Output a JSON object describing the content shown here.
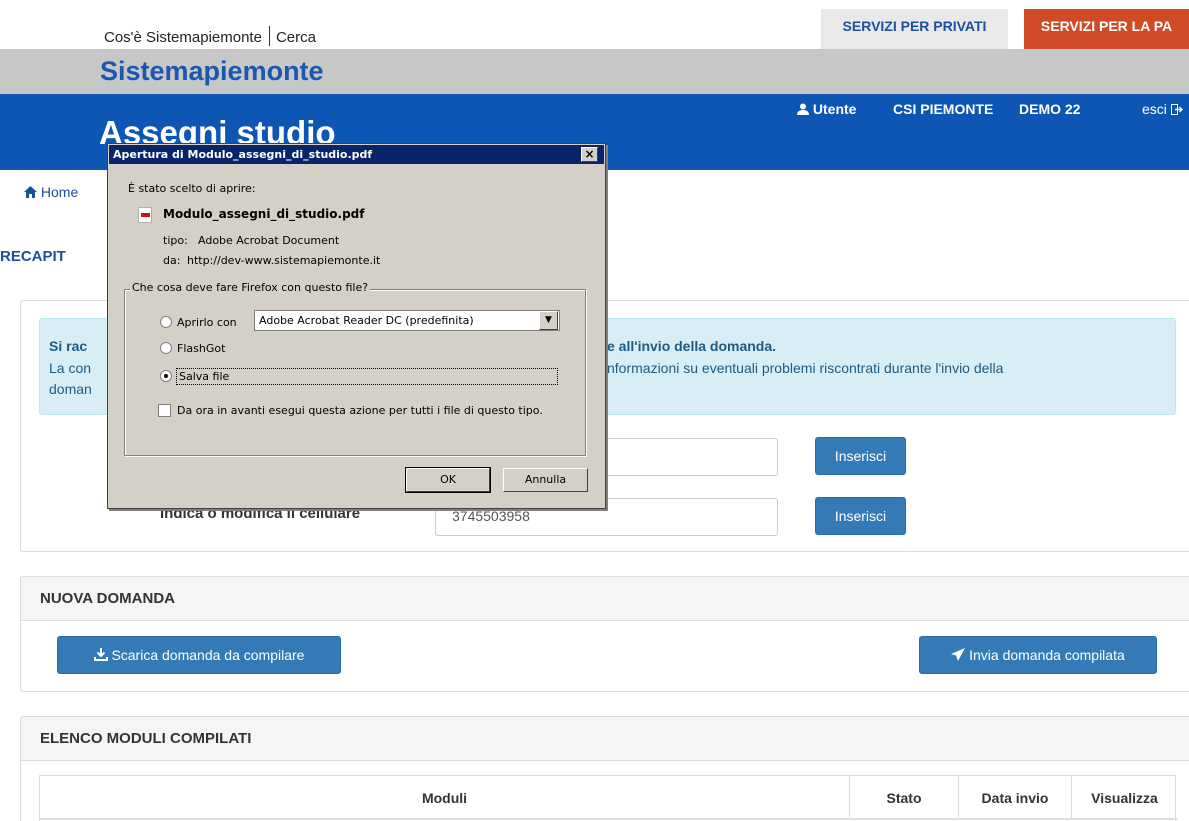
{
  "top": {
    "link_about": "Cos'è Sistemapiemonte",
    "link_search": "Cerca",
    "tab_private": "SERVIZI PER PRIVATI",
    "tab_pa": "SERVIZI PER LA PA"
  },
  "brand": "Sistemapiemonte",
  "header": {
    "app_title": "Assegni studio",
    "user_label": "Utente",
    "org": "CSI PIEMONTE",
    "demo": "DEMO 22",
    "logout": "esci"
  },
  "breadcrumb": {
    "home": "Home"
  },
  "recapiti": {
    "title": "RECAPIT",
    "alert_line1_start": "Si rac",
    "alert_line1_end": "e all'invio della domanda.",
    "alert_line2_start": "La con",
    "alert_line2_end": "nformazioni su eventuali problemi riscontrati durante l'invio della",
    "alert_line3_start": "doman",
    "cell_label": "Indica o modifica il cellulare",
    "cell_value": "3745503958",
    "insert_label": "Inserisci"
  },
  "nuova_domanda": {
    "title": "NUOVA DOMANDA",
    "download_label": "Scarica domanda da compilare",
    "send_label": "Invia domanda compilata"
  },
  "elenco": {
    "title": "ELENCO MODULI COMPILATI",
    "columns": [
      "Moduli",
      "Stato",
      "Data invio",
      "Visualizza"
    ]
  },
  "dialog": {
    "title": "Apertura di Modulo_assegni_di_studio.pdf",
    "chosen_label": "È stato scelto di aprire:",
    "filename": "Modulo_assegni_di_studio.pdf",
    "type_label": "tipo:",
    "type_value": "Adobe Acrobat Document",
    "from_label": "da:",
    "from_value": "http://dev-www.sistemapiemonte.it",
    "group_title": "Che cosa deve fare Firefox con questo file?",
    "option_open": "Aprirlo con",
    "open_with_value": "Adobe Acrobat Reader DC  (predefinita)",
    "option_flashgot": "FlashGot",
    "option_save": "Salva file",
    "remember_label": "Da ora in avanti esegui questa azione per tutti i file di questo tipo.",
    "ok_label": "OK",
    "cancel_label": "Annulla"
  },
  "colors": {
    "header_blue": "#0e56b4",
    "pa_orange": "#d04a25",
    "button_blue": "#337ab7",
    "alert_bg": "#d9edf7"
  }
}
